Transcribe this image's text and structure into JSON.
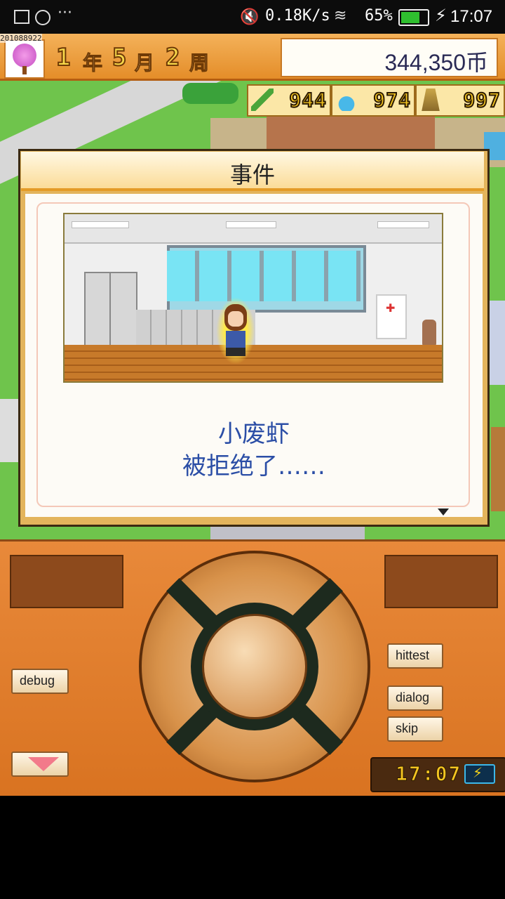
{
  "status_bar": {
    "network_speed": "0.18K/s",
    "battery_percent": "65%",
    "time": "17:07"
  },
  "hud": {
    "avatar_code": "201088922",
    "year_num": "1",
    "year_unit": "年",
    "month_num": "5",
    "month_unit": "月",
    "week_num": "2",
    "week_unit": "周",
    "money": "344,350币",
    "stats": [
      {
        "icon": "pencil-icon",
        "value": "944"
      },
      {
        "icon": "flask-icon",
        "value": "974"
      },
      {
        "icon": "trophy-icon",
        "value": "997"
      }
    ]
  },
  "dialog": {
    "title": "事件",
    "line1": "小废虾",
    "line2": "被拒绝了……"
  },
  "controller": {
    "buttons": {
      "debug": "debug",
      "hittest": "hittest",
      "dialog": "dialog",
      "skip": "skip"
    },
    "clock": "17:07"
  }
}
